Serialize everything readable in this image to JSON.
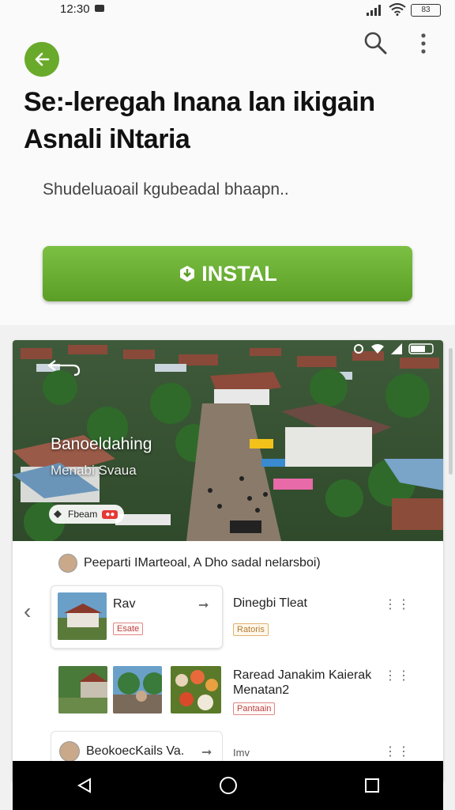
{
  "status_bar": {
    "time": "12:30",
    "battery": "83"
  },
  "header": {
    "title": "Se:-leregah Inana lan ikigain Asnali iNtaria",
    "subtitle": "Shudeluaoail kgubeadal bhaapn..",
    "install_label": "INSTAL"
  },
  "hero": {
    "title": "Banoeldahing",
    "subtitle": "Menabi Svaua",
    "chip_label": "Fbeam",
    "chip_badge": "●●"
  },
  "author_line": "Peeparti IMarteoal, A Dho sadal nelarsboi)",
  "items": [
    {
      "title": "Rav",
      "tag": "Esate"
    },
    {
      "title": "Dinegbi Tleat",
      "tag": "Ratoris"
    },
    {
      "title": "Raread Janakim Kaierak Menatan2",
      "tag": "Pantaain"
    },
    {
      "title": "BeokoecKails Va.",
      "title2": "Imv"
    }
  ],
  "colors": {
    "accent_green": "#6aaa2a",
    "install_green": "#6cb336",
    "nav_black": "#000000"
  },
  "icons": [
    "back-arrow-icon",
    "search-icon",
    "more-vert-icon",
    "back-nav-icon",
    "home-nav-icon",
    "recents-nav-icon"
  ]
}
